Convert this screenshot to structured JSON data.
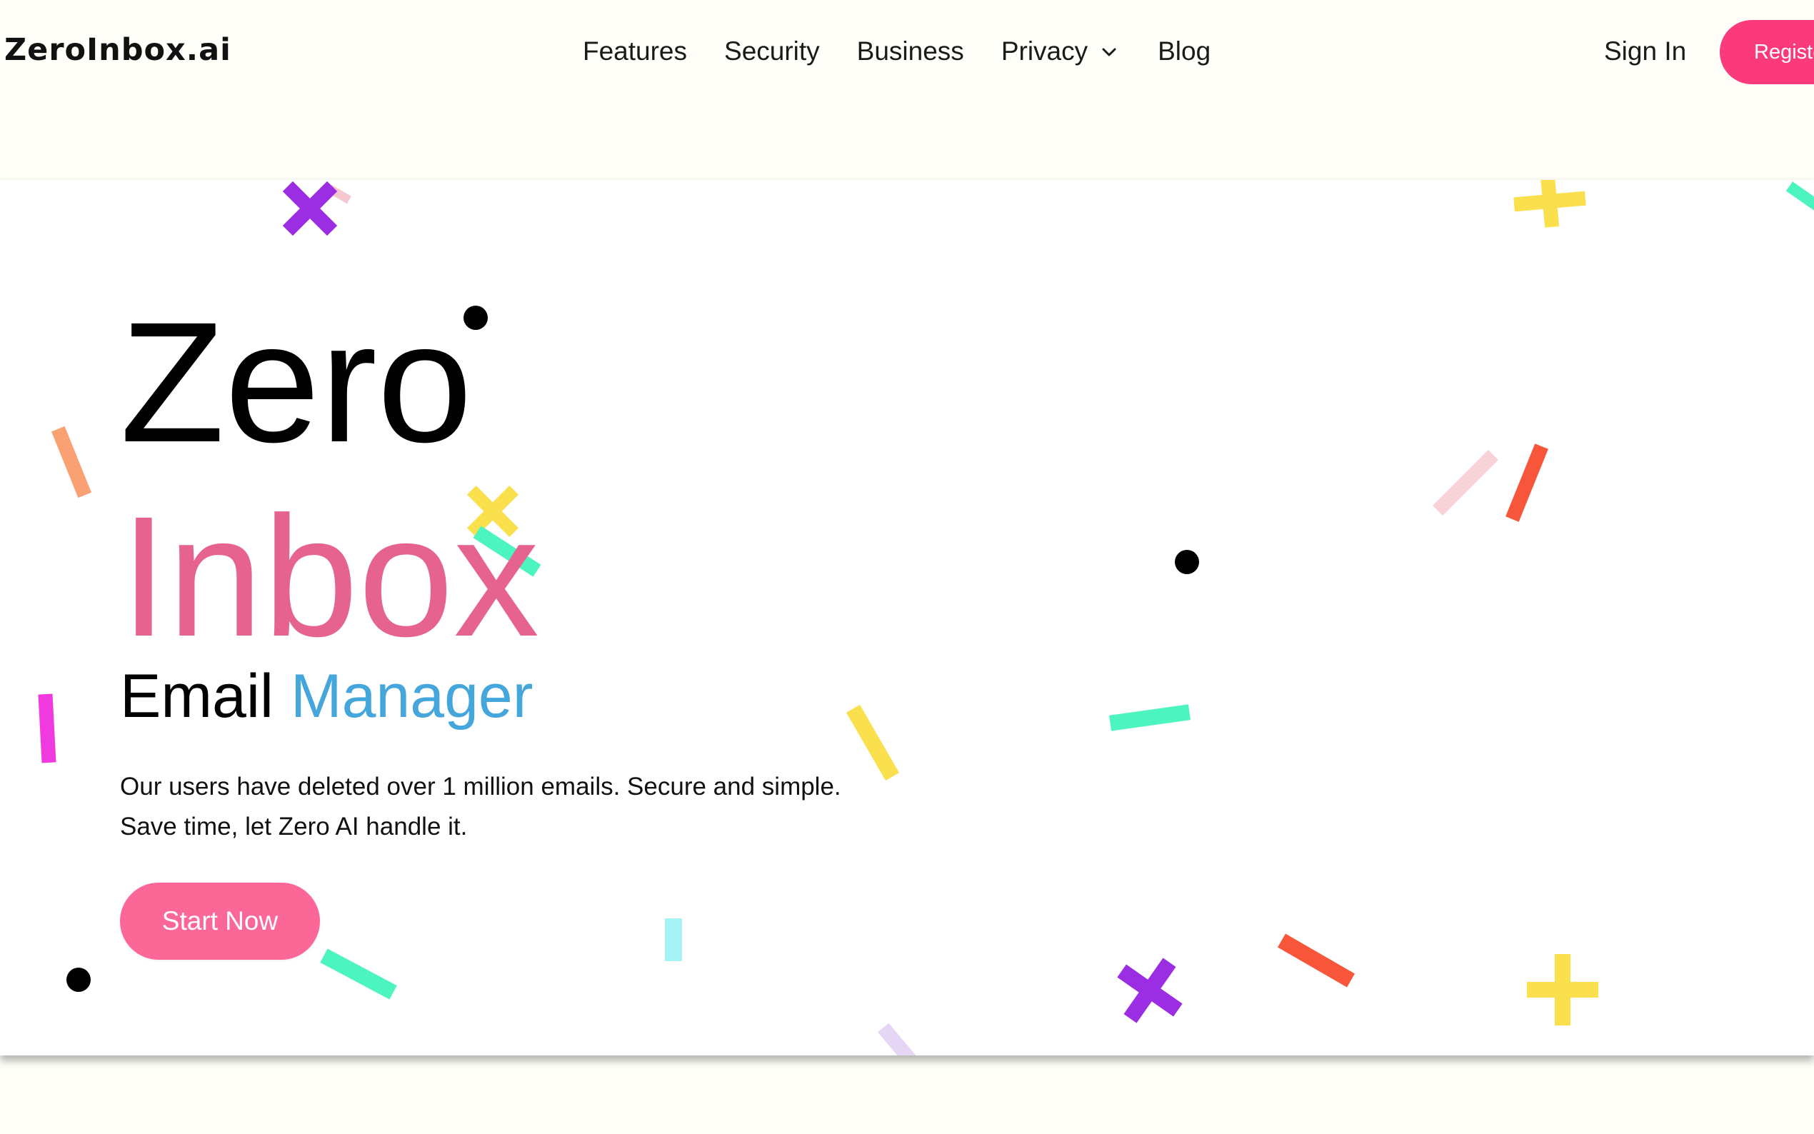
{
  "brand": "ZeroInbox.ai",
  "nav": {
    "items": [
      {
        "label": "Features",
        "icon": null
      },
      {
        "label": "Security",
        "icon": null
      },
      {
        "label": "Business",
        "icon": null
      },
      {
        "label": "Privacy",
        "icon": "chevron-down-icon"
      },
      {
        "label": "Blog",
        "icon": null
      }
    ],
    "sign_in": "Sign In",
    "register": "Register"
  },
  "hero": {
    "title_line1": "Zero",
    "title_line2": "Inbox",
    "subtitle_word1": "Email",
    "subtitle_word2": "Manager",
    "description_line1": "Our users have deleted over 1 million emails. Secure and simple.",
    "description_line2": "Save time, let Zero AI handle it.",
    "cta": "Start Now"
  },
  "colors": {
    "background": "#fffef8",
    "hero_background": "#ffffff",
    "accent_pink": "#fb3a7c",
    "inbox_pink": "#e6638f",
    "manager_blue": "#45a6db",
    "cta_pink": "#fb6796"
  }
}
